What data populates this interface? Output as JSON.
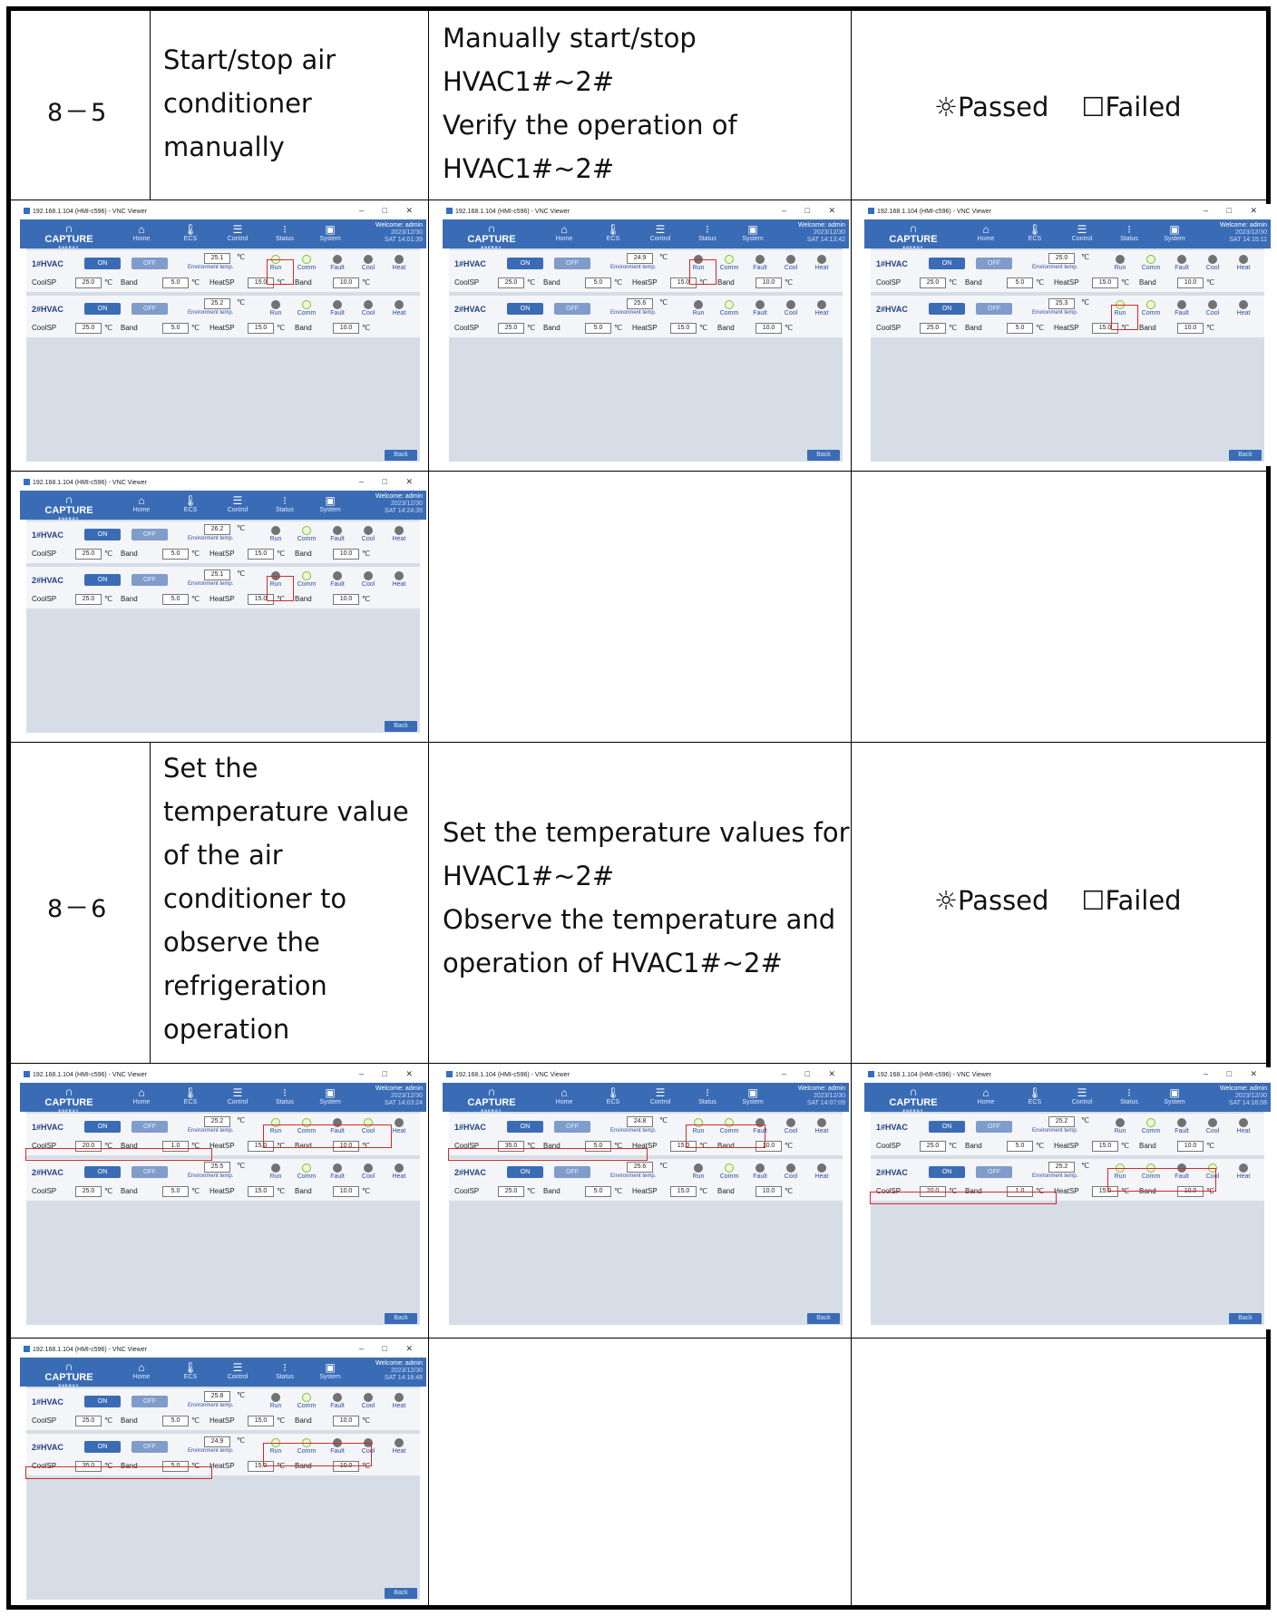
{
  "rows": [
    {
      "id": "8－5",
      "item": [
        "Start/stop air",
        "conditioner",
        "manually"
      ],
      "method": [
        "Manually start/stop",
        "HVAC1#~2#",
        "Verify the operation of",
        "HVAC1#~2#"
      ],
      "result": {
        "pass_glyph": "☼",
        "pass_label": "Passed",
        "fail_glyph": "☐",
        "fail_label": "Failed"
      }
    },
    {
      "id": "8－6",
      "item": [
        "Set the",
        "temperature value",
        "of the air",
        "conditioner to",
        "observe the",
        "refrigeration",
        "operation"
      ],
      "method": [
        "Set the temperature values for",
        "HVAC1#~2#",
        "Observe the temperature and",
        "operation of HVAC1#~2#"
      ],
      "result": {
        "pass_glyph": "☼",
        "pass_label": "Passed",
        "fail_glyph": "☐",
        "fail_label": "Failed"
      }
    }
  ],
  "hmi": {
    "window_title": "192.168.1.104 (HMI-c596) - VNC Viewer",
    "window_controls": "–  □  ✕",
    "logo": "CAPTURE",
    "logo_sub": "ENERGY",
    "nav": [
      {
        "icon": "⌂",
        "label": "Home"
      },
      {
        "icon": "🌡",
        "label": "ECS"
      },
      {
        "icon": "☰",
        "label": "Control"
      },
      {
        "icon": "⁝",
        "label": "Status"
      },
      {
        "icon": "▣",
        "label": "System"
      }
    ],
    "welcome": "Welcome: admin",
    "date": "2023/12/30",
    "on_label": "ON",
    "off_label": "OFF",
    "env_label": "Environment temp.",
    "unit": "℃",
    "led_labels": [
      "Run",
      "Comm",
      "Fault",
      "Cool",
      "Heat"
    ],
    "field_labels": {
      "coolsp": "CoolSP",
      "band": "Band",
      "heatsp": "HeatSP"
    },
    "back_label": "Back",
    "shots": [
      {
        "time": "SAT  14:01:39",
        "units": [
          {
            "name": "1#HVAC",
            "env": "25.1",
            "leds": [
              "g",
              "g",
              "d",
              "d",
              "d"
            ],
            "coolsp": "25.0",
            "band": "5.0",
            "heatsp": "15.0",
            "band2": "10.0"
          },
          {
            "name": "2#HVAC",
            "env": "25.2",
            "leds": [
              "d",
              "g",
              "d",
              "d",
              "d"
            ],
            "coolsp": "25.0",
            "band": "5.0",
            "heatsp": "15.0",
            "band2": "10.0"
          }
        ]
      },
      {
        "time": "SAT  14:13:42",
        "units": [
          {
            "name": "1#HVAC",
            "env": "24.9",
            "leds": [
              "d",
              "g",
              "d",
              "d",
              "d"
            ],
            "coolsp": "25.0",
            "band": "5.0",
            "heatsp": "15.0",
            "band2": "10.0"
          },
          {
            "name": "2#HVAC",
            "env": "25.6",
            "leds": [
              "d",
              "g",
              "d",
              "d",
              "d"
            ],
            "coolsp": "25.0",
            "band": "5.0",
            "heatsp": "15.0",
            "band2": "10.0"
          }
        ]
      },
      {
        "time": "SAT  14:15:11",
        "units": [
          {
            "name": "1#HVAC",
            "env": "25.0",
            "leds": [
              "d",
              "g",
              "d",
              "d",
              "d"
            ],
            "coolsp": "25.0",
            "band": "5.0",
            "heatsp": "15.0",
            "band2": "10.0"
          },
          {
            "name": "2#HVAC",
            "env": "25.3",
            "leds": [
              "g",
              "g",
              "d",
              "d",
              "d"
            ],
            "coolsp": "25.0",
            "band": "5.0",
            "heatsp": "15.0",
            "band2": "10.0"
          }
        ]
      },
      {
        "time": "SAT  14:24:35",
        "units": [
          {
            "name": "1#HVAC",
            "env": "26.2",
            "leds": [
              "d",
              "g",
              "d",
              "d",
              "d"
            ],
            "coolsp": "25.0",
            "band": "5.0",
            "heatsp": "15.0",
            "band2": "10.0"
          },
          {
            "name": "2#HVAC",
            "env": "25.1",
            "leds": [
              "d",
              "g",
              "d",
              "d",
              "d"
            ],
            "coolsp": "25.0",
            "band": "5.0",
            "heatsp": "15.0",
            "band2": "10.0"
          }
        ]
      },
      {
        "time": "SAT  14:03:24",
        "units": [
          {
            "name": "1#HVAC",
            "env": "25.2",
            "leds": [
              "g",
              "g",
              "d",
              "g",
              "d"
            ],
            "coolsp": "20.0",
            "band": "1.0",
            "heatsp": "15.0",
            "band2": "10.0"
          },
          {
            "name": "2#HVAC",
            "env": "25.5",
            "leds": [
              "d",
              "g",
              "d",
              "d",
              "d"
            ],
            "coolsp": "25.0",
            "band": "5.0",
            "heatsp": "15.0",
            "band2": "10.0"
          }
        ]
      },
      {
        "time": "SAT  14:07:09",
        "units": [
          {
            "name": "1#HVAC",
            "env": "24.8",
            "leds": [
              "g",
              "g",
              "d",
              "d",
              "d"
            ],
            "coolsp": "35.0",
            "band": "5.0",
            "heatsp": "15.0",
            "band2": "10.0"
          },
          {
            "name": "2#HVAC",
            "env": "25.6",
            "leds": [
              "d",
              "g",
              "d",
              "d",
              "d"
            ],
            "coolsp": "25.0",
            "band": "5.0",
            "heatsp": "15.0",
            "band2": "10.0"
          }
        ]
      },
      {
        "time": "SAT  14:16:08",
        "units": [
          {
            "name": "1#HVAC",
            "env": "25.2",
            "leds": [
              "d",
              "g",
              "d",
              "d",
              "d"
            ],
            "coolsp": "25.0",
            "band": "5.0",
            "heatsp": "15.0",
            "band2": "10.0"
          },
          {
            "name": "2#HVAC",
            "env": "25.2",
            "leds": [
              "g",
              "g",
              "d",
              "g",
              "d"
            ],
            "coolsp": "20.0",
            "band": "1.0",
            "heatsp": "15.0",
            "band2": "10.0"
          }
        ]
      },
      {
        "time": "SAT  14:18:48",
        "units": [
          {
            "name": "1#HVAC",
            "env": "25.8",
            "leds": [
              "d",
              "g",
              "d",
              "d",
              "d"
            ],
            "coolsp": "25.0",
            "band": "5.0",
            "heatsp": "15.0",
            "band2": "10.0"
          },
          {
            "name": "2#HVAC",
            "env": "24.9",
            "leds": [
              "g",
              "g",
              "d",
              "d",
              "d"
            ],
            "coolsp": "35.0",
            "band": "5.0",
            "heatsp": "15.0",
            "band2": "10.0"
          }
        ]
      }
    ]
  }
}
